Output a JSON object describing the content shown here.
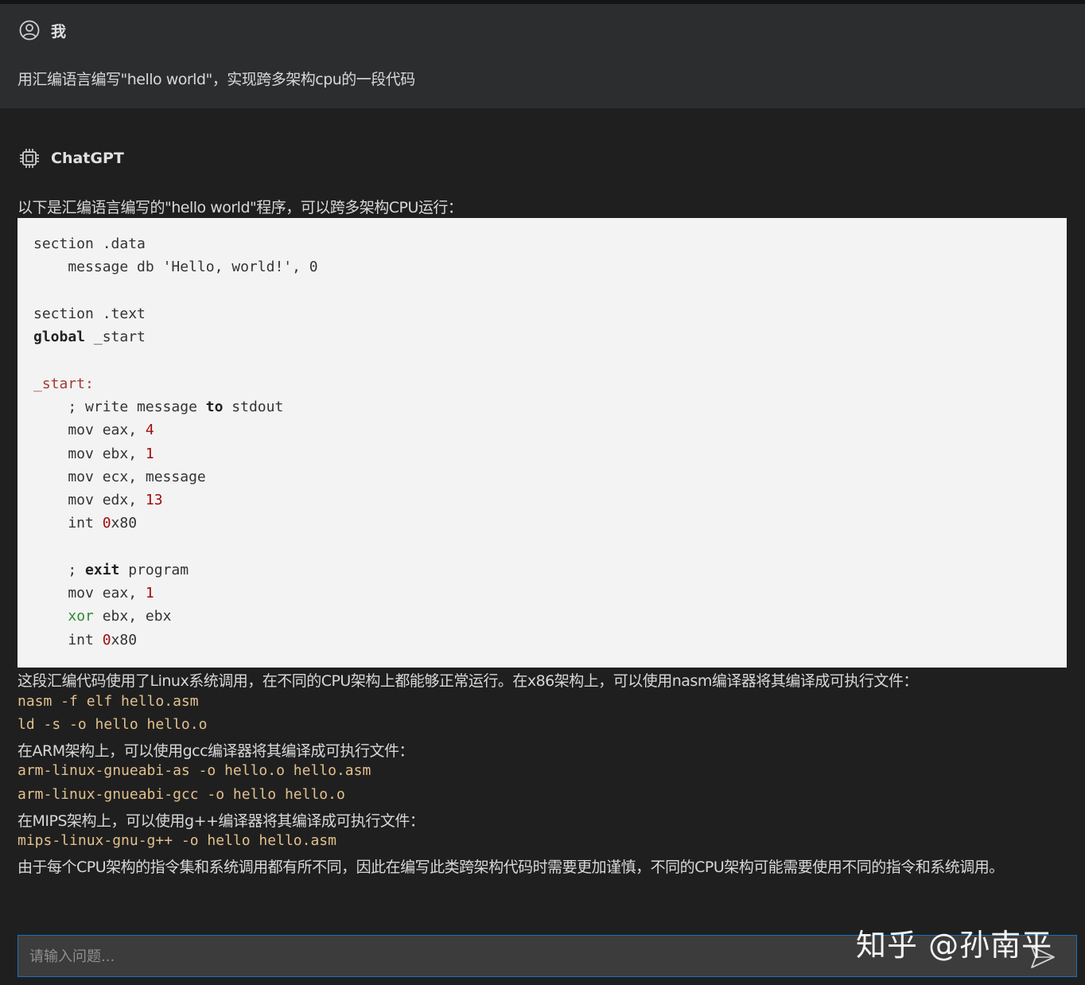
{
  "user": {
    "name": "我",
    "message": "用汇编语言编写\"hello world\"，实现跨多架构cpu的一段代码"
  },
  "bot": {
    "name": "ChatGPT",
    "intro": "以下是汇编语言编写的\"hello world\"程序，可以跨多架构CPU运行：",
    "code": {
      "l1": "section .data",
      "l2a": "    message db ",
      "l2b": "'Hello, world!'",
      "l2c": ", 0",
      "l3": "section .text",
      "l4a": "global",
      "l4b": " _start",
      "l5": "_start:",
      "l6a": "    ; write message ",
      "l6b": "to",
      "l6c": " stdout",
      "l7a": "    mov eax, ",
      "l7b": "4",
      "l8a": "    mov ebx, ",
      "l8b": "1",
      "l9": "    mov ecx, message",
      "l10a": "    mov edx, ",
      "l10b": "13",
      "l11a": "    int ",
      "l11b": "0",
      "l11c": "x80",
      "l12a": "    ; ",
      "l12b": "exit",
      "l12c": " program",
      "l13a": "    mov eax, ",
      "l13b": "1",
      "l14a": "    ",
      "l14b": "xor",
      "l14c": " ebx, ebx",
      "l15a": "    int ",
      "l15b": "0",
      "l15c": "x80"
    },
    "p1": "这段汇编代码使用了Linux系统调用，在不同的CPU架构上都能够正常运行。在x86架构上，可以使用nasm编译器将其编译成可执行文件：",
    "c1": "nasm -f elf hello.asm",
    "c2": "ld -s -o hello hello.o",
    "p2": "在ARM架构上，可以使用gcc编译器将其编译成可执行文件：",
    "c3": "arm-linux-gnueabi-as -o hello.o hello.asm",
    "c4": "arm-linux-gnueabi-gcc -o hello hello.o",
    "p3": "在MIPS架构上，可以使用g++编译器将其编译成可执行文件：",
    "c5": "mips-linux-gnu-g++ -o hello hello.asm",
    "p4": "由于每个CPU架构的指令集和系统调用都有所不同，因此在编写此类跨架构代码时需要更加谨慎，不同的CPU架构可能需要使用不同的指令和系统调用。"
  },
  "input": {
    "placeholder": "请输入问题..."
  },
  "watermark": "知乎 @孙南平",
  "colors": {
    "accent": "#1d6fb8",
    "command": "#e2c08d"
  }
}
